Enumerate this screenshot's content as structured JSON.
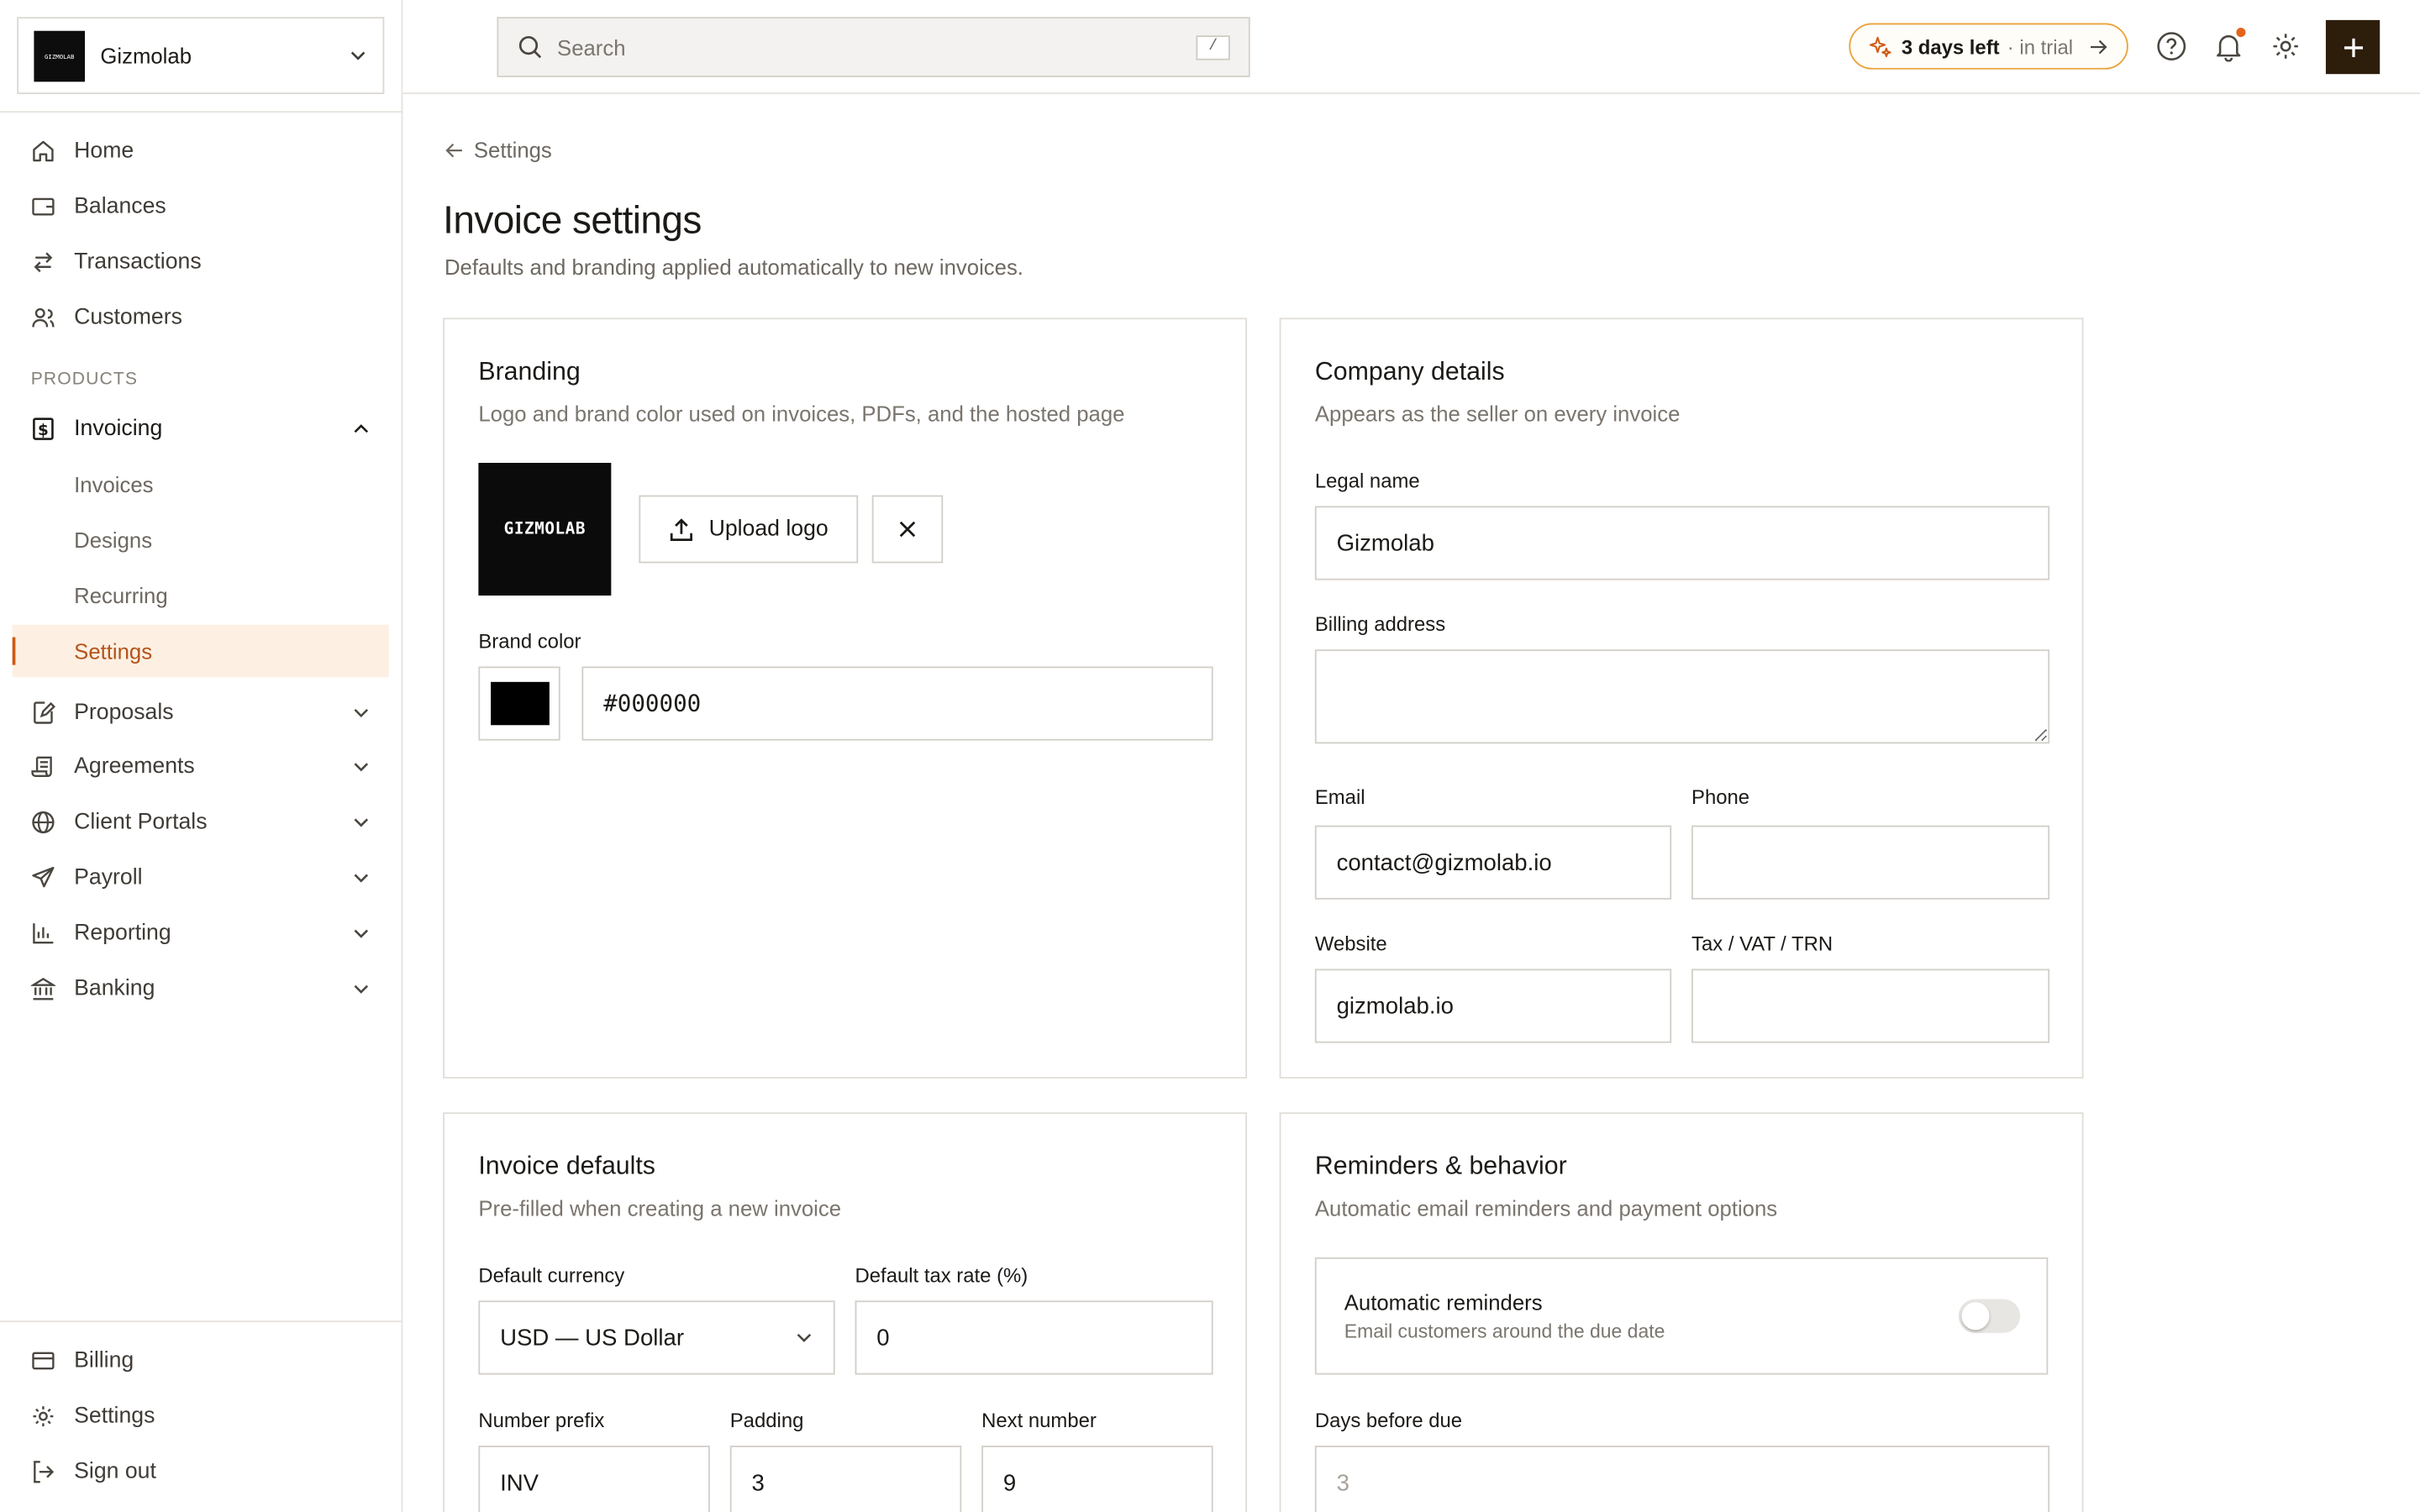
{
  "workspace": {
    "name": "Gizmolab",
    "logo_text": "GIZMOLAB"
  },
  "sidebar": {
    "items": [
      {
        "label": "Home",
        "icon": "home-icon"
      },
      {
        "label": "Balances",
        "icon": "wallet-icon"
      },
      {
        "label": "Transactions",
        "icon": "arrows-swap-icon"
      },
      {
        "label": "Customers",
        "icon": "users-icon"
      }
    ],
    "section_label": "PRODUCTS",
    "invoicing": {
      "label": "Invoicing",
      "icon": "invoice-dollar-icon",
      "children": [
        "Invoices",
        "Designs",
        "Recurring",
        "Settings"
      ],
      "active_child": "Settings"
    },
    "collapsibles": [
      {
        "label": "Proposals",
        "icon": "document-edit-icon"
      },
      {
        "label": "Agreements",
        "icon": "scroll-icon"
      },
      {
        "label": "Client Portals",
        "icon": "globe-icon"
      },
      {
        "label": "Payroll",
        "icon": "send-icon"
      },
      {
        "label": "Reporting",
        "icon": "bar-chart-icon"
      },
      {
        "label": "Banking",
        "icon": "bank-icon"
      }
    ],
    "bottom": [
      {
        "label": "Billing",
        "icon": "credit-card-icon"
      },
      {
        "label": "Settings",
        "icon": "gear-icon"
      },
      {
        "label": "Sign out",
        "icon": "sign-out-icon"
      }
    ]
  },
  "topbar": {
    "search_placeholder": "Search",
    "search_shortcut": "/",
    "trial_strong": "3 days left",
    "trial_weak": "· in trial",
    "plus_label": "+"
  },
  "page": {
    "breadcrumb": "Settings",
    "title": "Invoice settings",
    "subtitle": "Defaults and branding applied automatically to new invoices."
  },
  "branding": {
    "title": "Branding",
    "subtitle": "Logo and brand color used on invoices, PDFs, and the hosted page",
    "logo_text": "GIZMOLAB",
    "upload_label": "Upload logo",
    "brand_color_label": "Brand color",
    "brand_color_value": "#000000"
  },
  "company": {
    "title": "Company details",
    "subtitle": "Appears as the seller on every invoice",
    "legal_name_label": "Legal name",
    "legal_name_value": "Gizmolab",
    "billing_address_label": "Billing address",
    "billing_address_value": "",
    "email_label": "Email",
    "email_value": "contact@gizmolab.io",
    "phone_label": "Phone",
    "phone_value": "",
    "website_label": "Website",
    "website_value": "gizmolab.io",
    "tax_label": "Tax / VAT / TRN",
    "tax_value": ""
  },
  "defaults": {
    "title": "Invoice defaults",
    "subtitle": "Pre-filled when creating a new invoice",
    "currency_label": "Default currency",
    "currency_value": "USD — US Dollar",
    "tax_rate_label": "Default tax rate (%)",
    "tax_rate_value": "0",
    "prefix_label": "Number prefix",
    "prefix_value": "INV",
    "padding_label": "Padding",
    "padding_value": "3",
    "next_label": "Next number",
    "next_value": "9"
  },
  "reminders": {
    "title": "Reminders & behavior",
    "subtitle": "Automatic email reminders and payment options",
    "toggle_title": "Automatic reminders",
    "toggle_sub": "Email customers around the due date",
    "toggle_on": false,
    "days_label": "Days before due",
    "days_value": "3"
  },
  "colors": {
    "accent": "#d05a12",
    "active_bg": "#fdf0e3",
    "trial_border": "#e9a33c",
    "primary_btn": "#2d1d0b"
  }
}
